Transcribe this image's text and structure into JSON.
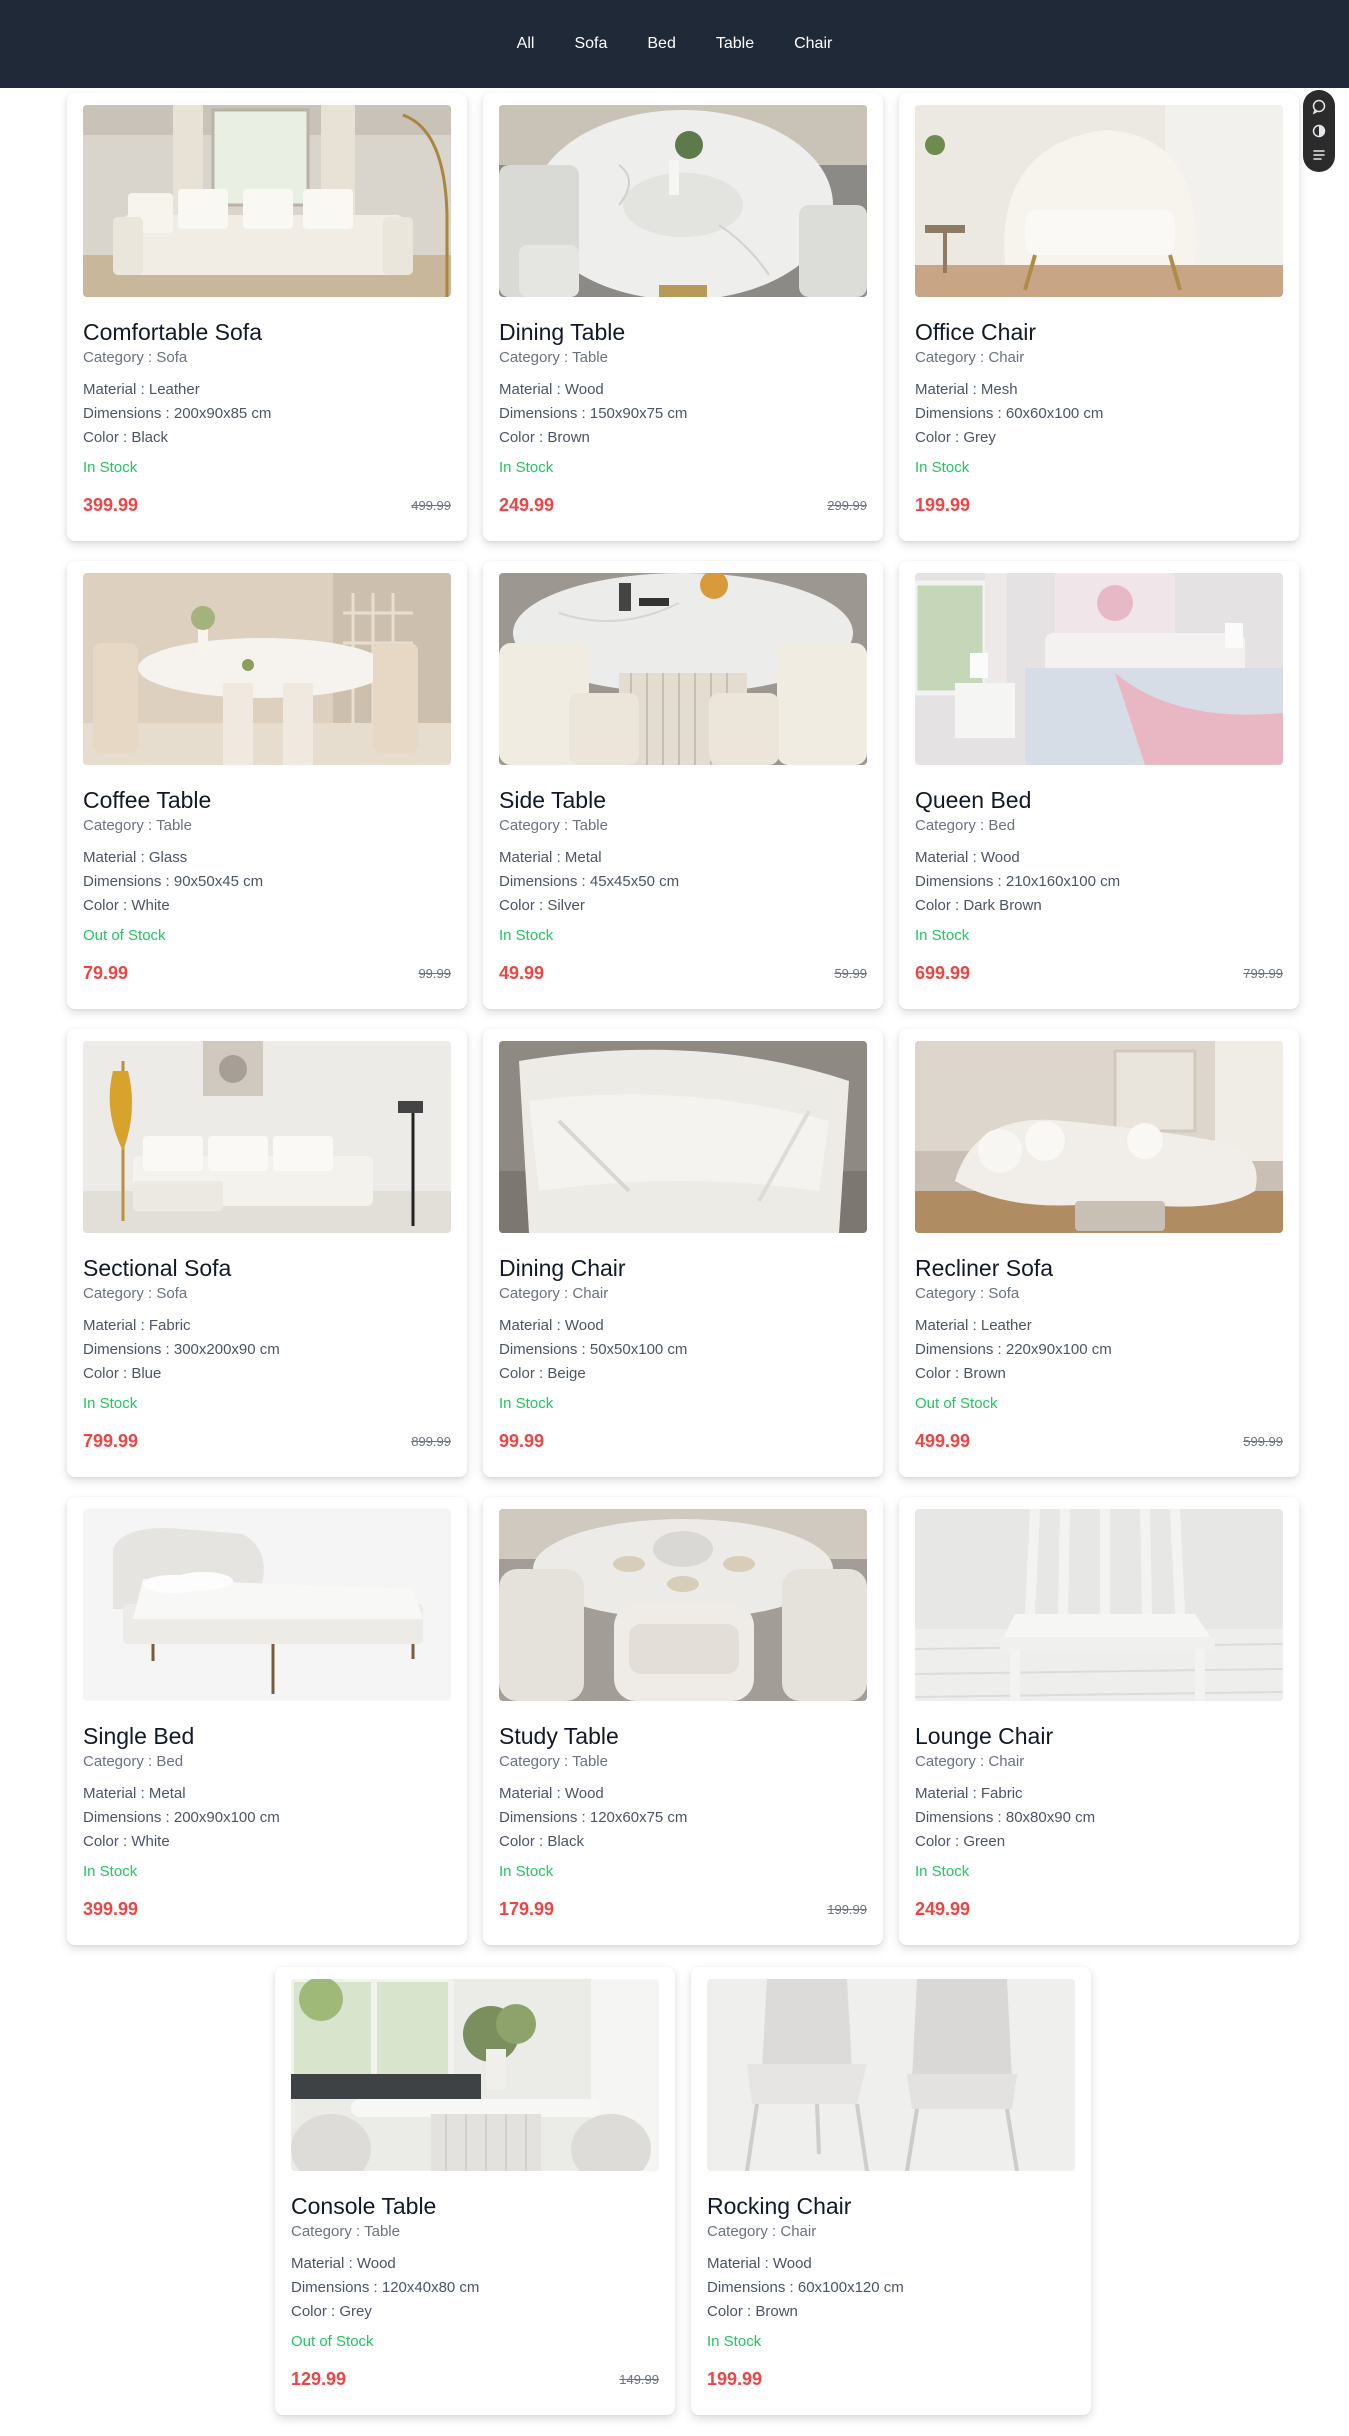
{
  "nav": {
    "items": [
      "All",
      "Sofa",
      "Bed",
      "Table",
      "Chair"
    ]
  },
  "toolbar": {
    "icons": [
      "chat-icon",
      "theme-toggle-icon",
      "menu-icon"
    ]
  },
  "labels": {
    "category_prefix": "Category : ",
    "material_prefix": "Material : ",
    "dimensions_prefix": "Dimensions : ",
    "color_prefix": "Color : "
  },
  "products": [
    {
      "name": "Comfortable Sofa",
      "category": "Category : Sofa",
      "material": "Material : Leather",
      "dimensions": "Dimensions : 200x90x85 cm",
      "color": "Color : Black",
      "stock": "In Stock",
      "price": "399.99",
      "old_price": "499.99",
      "image": "sofa-image"
    },
    {
      "name": "Dining Table",
      "category": "Category : Table",
      "material": "Material : Wood",
      "dimensions": "Dimensions : 150x90x75 cm",
      "color": "Color : Brown",
      "stock": "In Stock",
      "price": "249.99",
      "old_price": "299.99",
      "image": "round-table-image"
    },
    {
      "name": "Office Chair",
      "category": "Category : Chair",
      "material": "Material : Mesh",
      "dimensions": "Dimensions : 60x60x100 cm",
      "color": "Color : Grey",
      "stock": "In Stock",
      "price": "199.99",
      "old_price": "",
      "image": "armchair-image"
    },
    {
      "name": "Coffee Table",
      "category": "Category : Table",
      "material": "Material : Glass",
      "dimensions": "Dimensions : 90x50x45 cm",
      "color": "Color : White",
      "stock": "Out of Stock",
      "price": "79.99",
      "old_price": "99.99",
      "image": "oval-table-image"
    },
    {
      "name": "Side Table",
      "category": "Category : Table",
      "material": "Material : Metal",
      "dimensions": "Dimensions : 45x45x50 cm",
      "color": "Color : Silver",
      "stock": "In Stock",
      "price": "49.99",
      "old_price": "59.99",
      "image": "pedestal-table-image"
    },
    {
      "name": "Queen Bed",
      "category": "Category : Bed",
      "material": "Material : Wood",
      "dimensions": "Dimensions : 210x160x100 cm",
      "color": "Color : Dark Brown",
      "stock": "In Stock",
      "price": "699.99",
      "old_price": "799.99",
      "image": "bedroom-image"
    },
    {
      "name": "Sectional Sofa",
      "category": "Category : Sofa",
      "material": "Material : Fabric",
      "dimensions": "Dimensions : 300x200x90 cm",
      "color": "Color : Blue",
      "stock": "In Stock",
      "price": "799.99",
      "old_price": "899.99",
      "image": "sectional-sofa-image"
    },
    {
      "name": "Dining Chair",
      "category": "Category : Chair",
      "material": "Material : Wood",
      "dimensions": "Dimensions : 50x50x100 cm",
      "color": "Color : Beige",
      "stock": "In Stock",
      "price": "99.99",
      "old_price": "",
      "image": "chair-closeup-image"
    },
    {
      "name": "Recliner Sofa",
      "category": "Category : Sofa",
      "material": "Material : Leather",
      "dimensions": "Dimensions : 220x90x100 cm",
      "color": "Color : Brown",
      "stock": "Out of Stock",
      "price": "499.99",
      "old_price": "599.99",
      "image": "curved-sofa-image"
    },
    {
      "name": "Single Bed",
      "category": "Category : Bed",
      "material": "Material : Metal",
      "dimensions": "Dimensions : 200x90x100 cm",
      "color": "Color : White",
      "stock": "In Stock",
      "price": "399.99",
      "old_price": "",
      "image": "bed-image"
    },
    {
      "name": "Study Table",
      "category": "Category : Table",
      "material": "Material : Wood",
      "dimensions": "Dimensions : 120x60x75 cm",
      "color": "Color : Black",
      "stock": "In Stock",
      "price": "179.99",
      "old_price": "199.99",
      "image": "boucle-dining-image"
    },
    {
      "name": "Lounge Chair",
      "category": "Category : Chair",
      "material": "Material : Fabric",
      "dimensions": "Dimensions : 80x80x90 cm",
      "color": "Color : Green",
      "stock": "In Stock",
      "price": "249.99",
      "old_price": "",
      "image": "white-chair-image"
    },
    {
      "name": "Console Table",
      "category": "Category : Table",
      "material": "Material : Wood",
      "dimensions": "Dimensions : 120x40x80 cm",
      "color": "Color : Grey",
      "stock": "Out of Stock",
      "price": "129.99",
      "old_price": "149.99",
      "image": "console-table-image"
    },
    {
      "name": "Rocking Chair",
      "category": "Category : Chair",
      "material": "Material : Wood",
      "dimensions": "Dimensions : 60x100x120 cm",
      "color": "Color : Brown",
      "stock": "In Stock",
      "price": "199.99",
      "old_price": "",
      "image": "two-chairs-image"
    }
  ]
}
